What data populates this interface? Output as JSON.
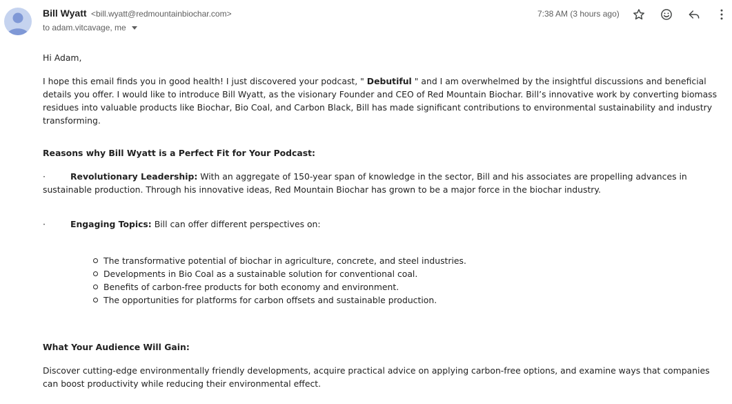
{
  "email": {
    "sender_name": "Bill Wyatt",
    "sender_email": "<bill.wyatt@redmountainbiochar.com>",
    "recipients": "to adam.vitcavage, me",
    "time": "7:38 AM (3 hours ago)",
    "icons": {
      "avatar": "default-avatar-icon",
      "star": "star-icon",
      "emoji": "emoji-reaction-icon",
      "reply": "reply-icon",
      "more": "more-vertical-icon",
      "recipients_toggle": "caret-down-icon"
    },
    "colors": {
      "avatar_bg": "#c5d3ef",
      "avatar_fg": "#7f98d6"
    }
  },
  "body": {
    "greeting": "Hi Adam,",
    "intro_before": "I hope this email finds you in good health! I just discovered your podcast, \" ",
    "intro_podcast": "Debutiful",
    "intro_after": " \" and I am overwhelmed by the insightful discussions and beneficial details you offer. I would like to introduce Bill Wyatt, as the visionary Founder and CEO of Red Mountain Biochar. Bill’s innovative work by converting biomass residues into valuable products like Biochar, Bio Coal, and Carbon Black, Bill has made significant contributions to environmental sustainability and industry transforming.",
    "reasons_heading": "Reasons why Bill Wyatt is a Perfect Fit for Your Podcast:",
    "bullets": [
      {
        "marker": "·",
        "title": "Revolutionary Leadership:",
        "text": " With an aggregate of 150-year span of knowledge in the sector, Bill and his associates are propelling advances in sustainable production. Through his innovative ideas, Red Mountain Biochar has grown to be a major force in the biochar industry."
      },
      {
        "marker": "·",
        "title": "Engaging Topics:",
        "text": " Bill can offer different perspectives on:"
      }
    ],
    "topics": [
      "The transformative potential of biochar in agriculture, concrete, and steel industries.",
      "Developments in Bio Coal as a sustainable solution for conventional coal.",
      "Benefits of carbon-free products for both economy and environment.",
      "The opportunities for platforms for carbon offsets and sustainable production."
    ],
    "gain_heading": "What Your Audience Will Gain:",
    "gain_text": "Discover cutting-edge environmentally friendly developments, acquire practical advice on applying carbon-free options, and examine ways that companies can boost productivity while reducing their environmental effect."
  }
}
